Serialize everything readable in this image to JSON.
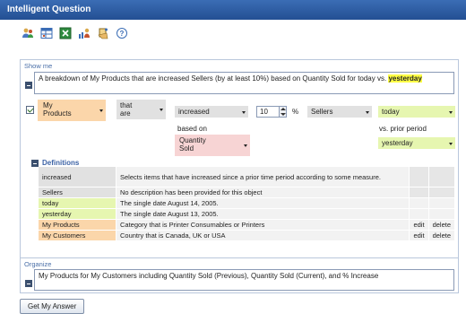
{
  "window": {
    "title": "Intelligent Question"
  },
  "toolbar": {
    "icons": [
      "users-icon",
      "table-icon",
      "spreadsheet-icon",
      "user-chart-icon",
      "hand-icon",
      "help-icon"
    ],
    "help_glyph": "?"
  },
  "show_me": {
    "label": "Show me",
    "question_text": "A breakdown of My Products that are increased Sellers (by at least 10%) based on Quantity Sold for today vs.",
    "question_highlight": "yesterday"
  },
  "criteria": {
    "subject": "My Products",
    "verb": "that are",
    "comparison": "increased",
    "threshold": "10",
    "percent_sign": "%",
    "measure_group": "Sellers",
    "current_period": "today",
    "based_on_label": "based on",
    "measure": "Quantity Sold",
    "vs_label": "vs. prior period",
    "prior_period": "yesterday"
  },
  "definitions": {
    "heading": "Definitions",
    "rows": [
      {
        "term": "increased",
        "description": "Selects items that have increased since a prior time period according to some measure.",
        "edit": "",
        "delete": ""
      },
      {
        "term": "Sellers",
        "description": "No description has been provided for this object",
        "edit": "",
        "delete": ""
      },
      {
        "term": "today",
        "description": "The single date August 14, 2005.",
        "edit": "",
        "delete": ""
      },
      {
        "term": "yesterday",
        "description": "The single date August 13, 2005.",
        "edit": "",
        "delete": ""
      },
      {
        "term": "My Products",
        "description": "Category that is Printer Consumables or Printers",
        "edit": "edit",
        "delete": "delete"
      },
      {
        "term": "My Customers",
        "description": "Country that is Canada, UK or USA",
        "edit": "edit",
        "delete": "delete"
      }
    ]
  },
  "organize": {
    "label": "Organize",
    "text": "My Products for My Customers including Quantity Sold (Previous), Quantity Sold (Current), and % Increase"
  },
  "actions": {
    "submit_label": "Get My Answer"
  },
  "colors": {
    "title_bar": "#2f5ea3",
    "subject_bg": "#fbd6aa",
    "period_bg": "#e6f6b0",
    "measure_bg": "#f7d4d4",
    "neutral_bg": "#e1e1e1",
    "highlight": "#ffff44"
  }
}
